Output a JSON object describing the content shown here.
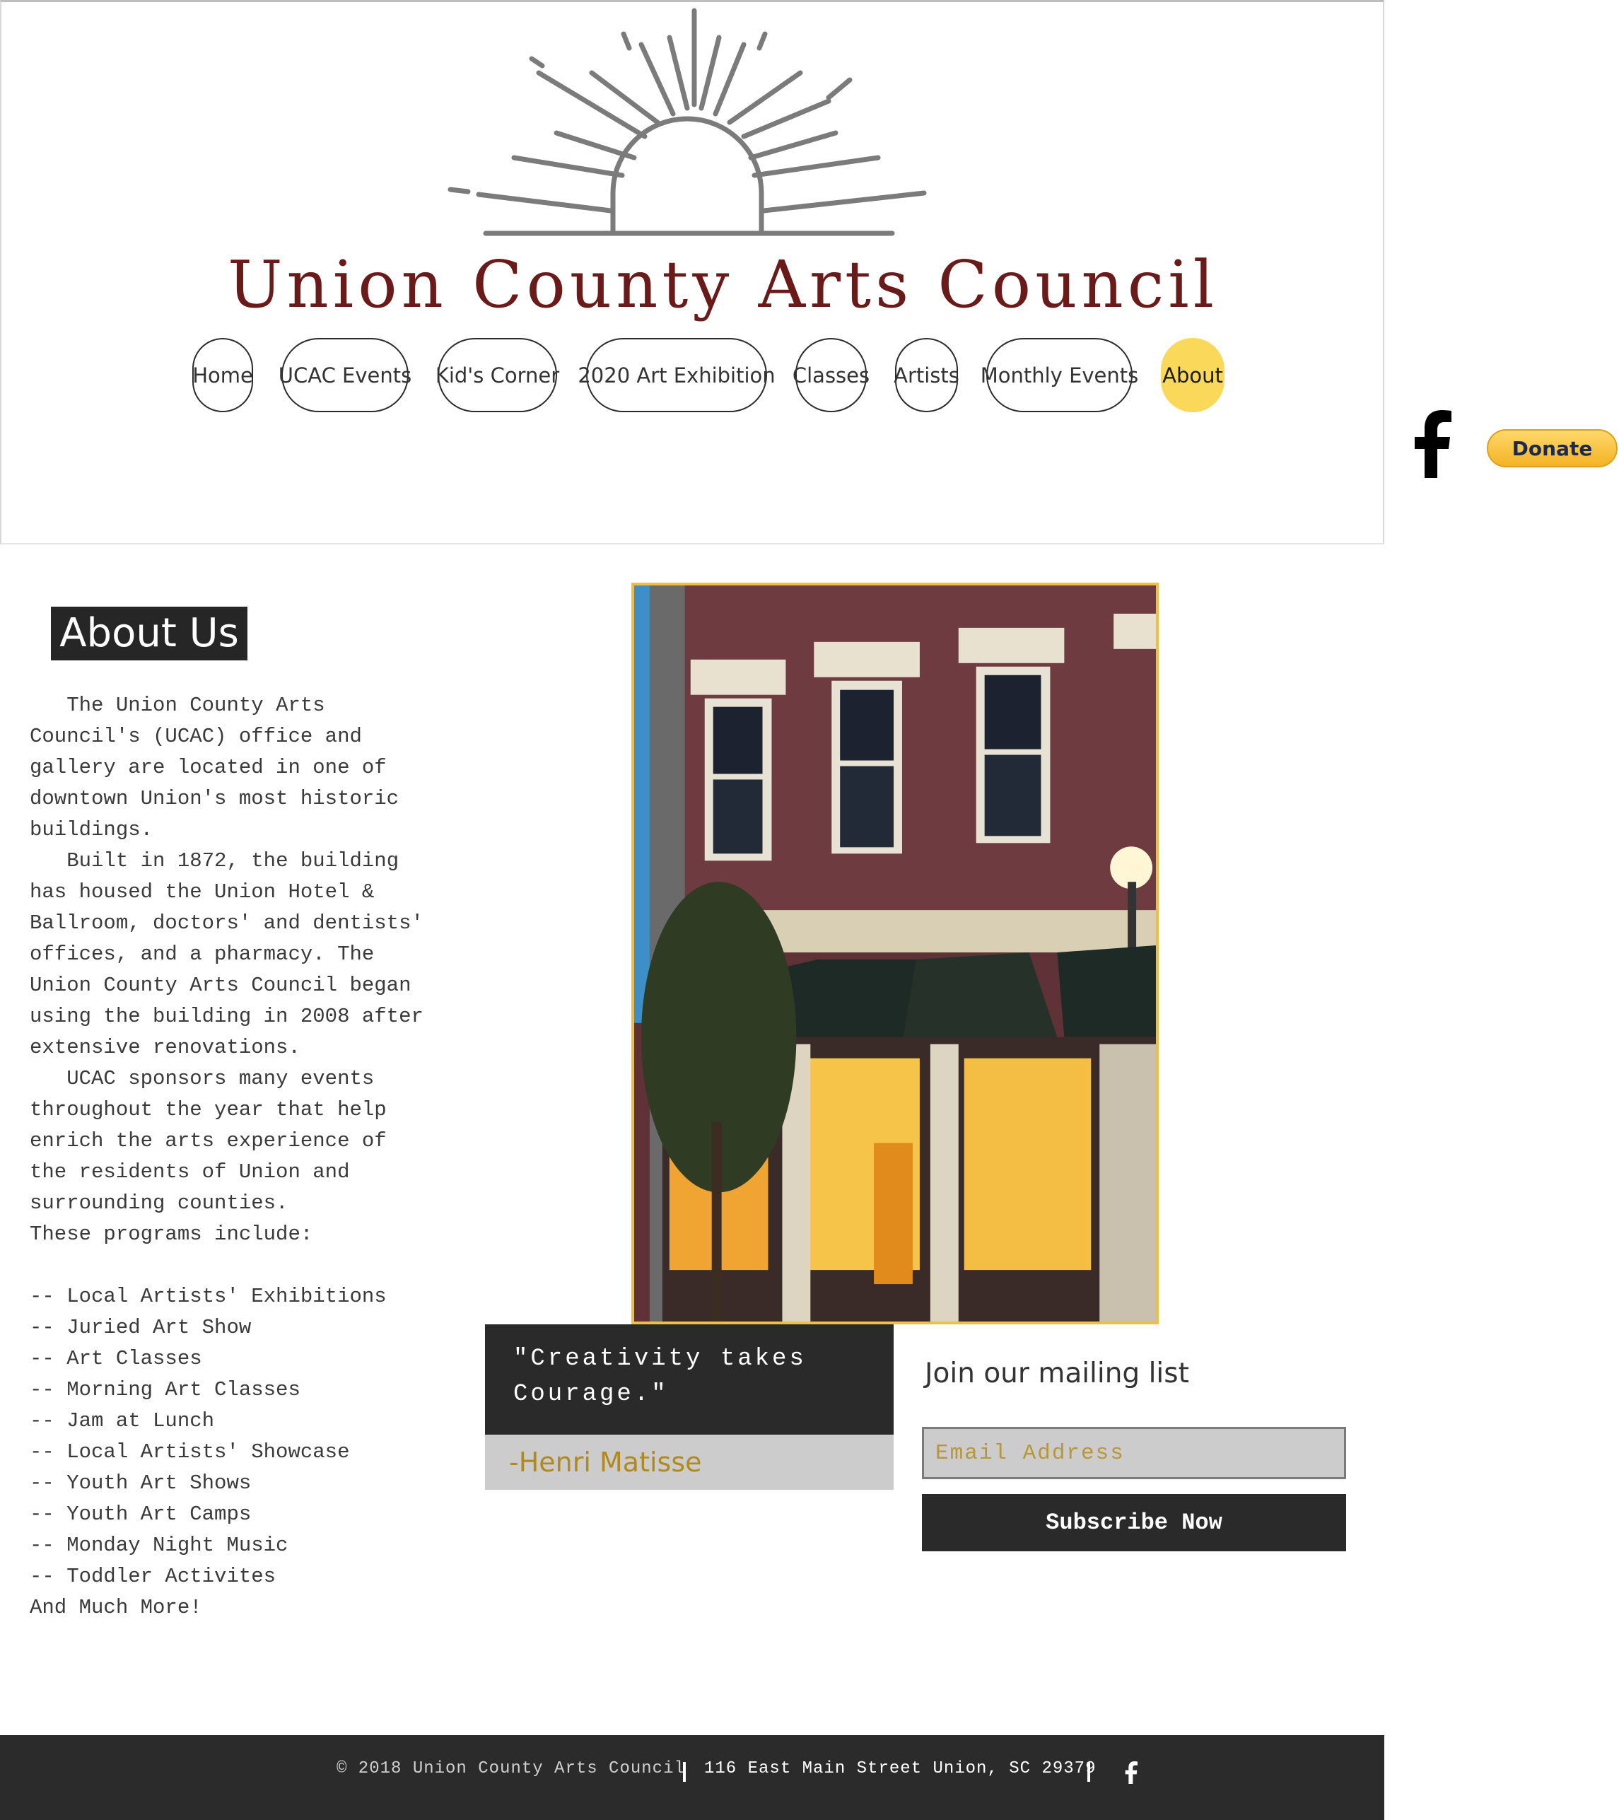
{
  "header": {
    "site_title": "Union County Arts Council",
    "nav": [
      {
        "label": "Home",
        "active": false
      },
      {
        "label": "UCAC Events",
        "active": false
      },
      {
        "label": "Kid's Corner",
        "active": false
      },
      {
        "label": "2020 Art Exhibition",
        "active": false
      },
      {
        "label": "Classes",
        "active": false
      },
      {
        "label": "Artists",
        "active": false
      },
      {
        "label": "Monthly Events",
        "active": false
      },
      {
        "label": "About",
        "active": true
      }
    ]
  },
  "social": {
    "facebook_icon": "facebook-icon",
    "donate_label": "Donate"
  },
  "about": {
    "heading": "About Us",
    "body": "   The Union County Arts\nCouncil's (UCAC) office and\ngallery are located in one of\ndowntown Union's most historic\nbuildings.\n   Built in 1872, the building\nhas housed the Union Hotel &\nBallroom, doctors' and dentists'\noffices, and a pharmacy. The\nUnion County Arts Council began\nusing the building in 2008 after\nextensive renovations.\n   UCAC sponsors many events\nthroughout the year that help\nenrich the arts experience of\nthe residents of Union and\nsurrounding counties.\nThese programs include:\n\n-- Local Artists' Exhibitions\n-- Juried Art Show\n-- Art Classes\n-- Morning Art Classes\n-- Jam at Lunch\n-- Local Artists' Showcase\n-- Youth Art Shows\n-- Youth Art Camps\n-- Monday Night Music\n-- Toddler Activites\nAnd Much More!"
  },
  "quote": {
    "text": "\"Creativity takes Courage.\"",
    "author": "-Henri Matisse"
  },
  "mailing": {
    "title": "Join our mailing list",
    "email_placeholder": "Email Address",
    "subscribe_label": "Subscribe Now"
  },
  "footer": {
    "copyright": "© 2018 Union County Arts Council",
    "address": "116 East Main Street Union, SC 29379"
  },
  "colors": {
    "title": "#6b1a1a",
    "active_nav": "#fad95a",
    "photo_border": "#f2bd43",
    "dark": "#2a2a2a",
    "gold_text": "#b08a1c"
  }
}
